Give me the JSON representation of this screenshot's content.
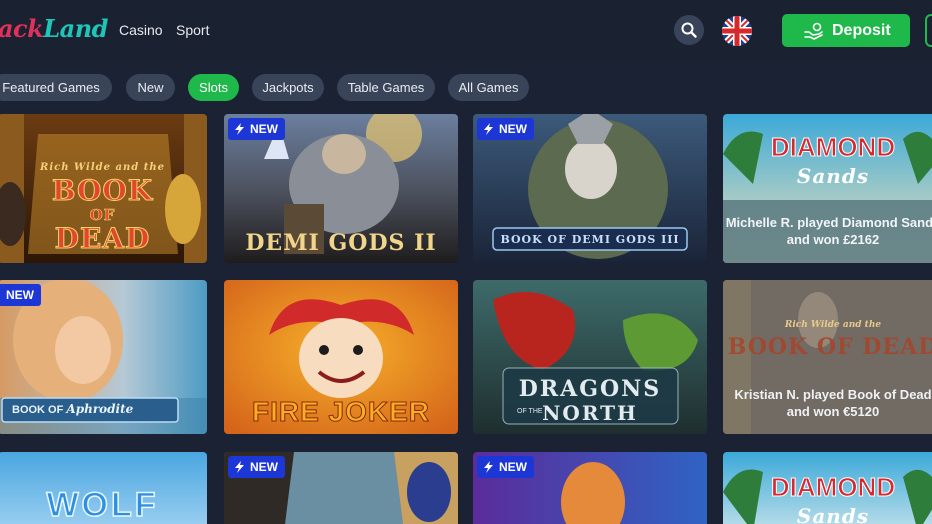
{
  "header": {
    "logo_part1": "ack",
    "logo_part2": "Land",
    "nav": {
      "casino": "Casino",
      "sport": "Sport"
    },
    "search_icon": "search-icon",
    "flag_icon": "uk-flag-icon",
    "deposit_label": "Deposit",
    "deposit_icon": "hand-coin-icon"
  },
  "tabs": {
    "featured": "Featured Games",
    "new": "New",
    "slots": "Slots",
    "jackpots": "Jackpots",
    "table": "Table Games",
    "all": "All Games",
    "active": "Slots"
  },
  "games": {
    "badge_new": "NEW",
    "book_of_dead": {
      "line1": "Rich Wilde and the",
      "line2": "BOOK",
      "line3": "OF",
      "line4": "DEAD"
    },
    "demi_gods_2": {
      "title": "DEMI GODS II"
    },
    "book_of_demi_gods_3": {
      "title": "BOOK OF DEMI GODS III"
    },
    "diamond_sands": {
      "line1": "DIAMOND",
      "line2": "Sands"
    },
    "book_of_aphrodite": {
      "prefix": "BOOK OF",
      "name": "Aphrodite"
    },
    "fire_joker": {
      "title": "FIRE JOKER"
    },
    "dragons_north": {
      "line1": "DRAGONS",
      "line2": "OF THE",
      "line3": "NORTH"
    },
    "book_of_dead_2": {
      "line1": "Rich Wilde and the",
      "line2": "BOOK OF DEAD"
    },
    "wolf": {
      "title": "WOLF"
    },
    "diamond_sands_2": {
      "line1": "DIAMOND",
      "line2": "Sands"
    }
  },
  "wins": {
    "win1_line1": "Michelle R. played Diamond Sands",
    "win1_line2": "and won £2162",
    "win2_line1": "Kristian N. played Book of Dead",
    "win2_line2": "and won €5120"
  },
  "colors": {
    "background": "#1b2233",
    "accent_green": "#1fb84a",
    "badge_blue": "#1c37d6",
    "tab_grey": "#3a4458"
  }
}
